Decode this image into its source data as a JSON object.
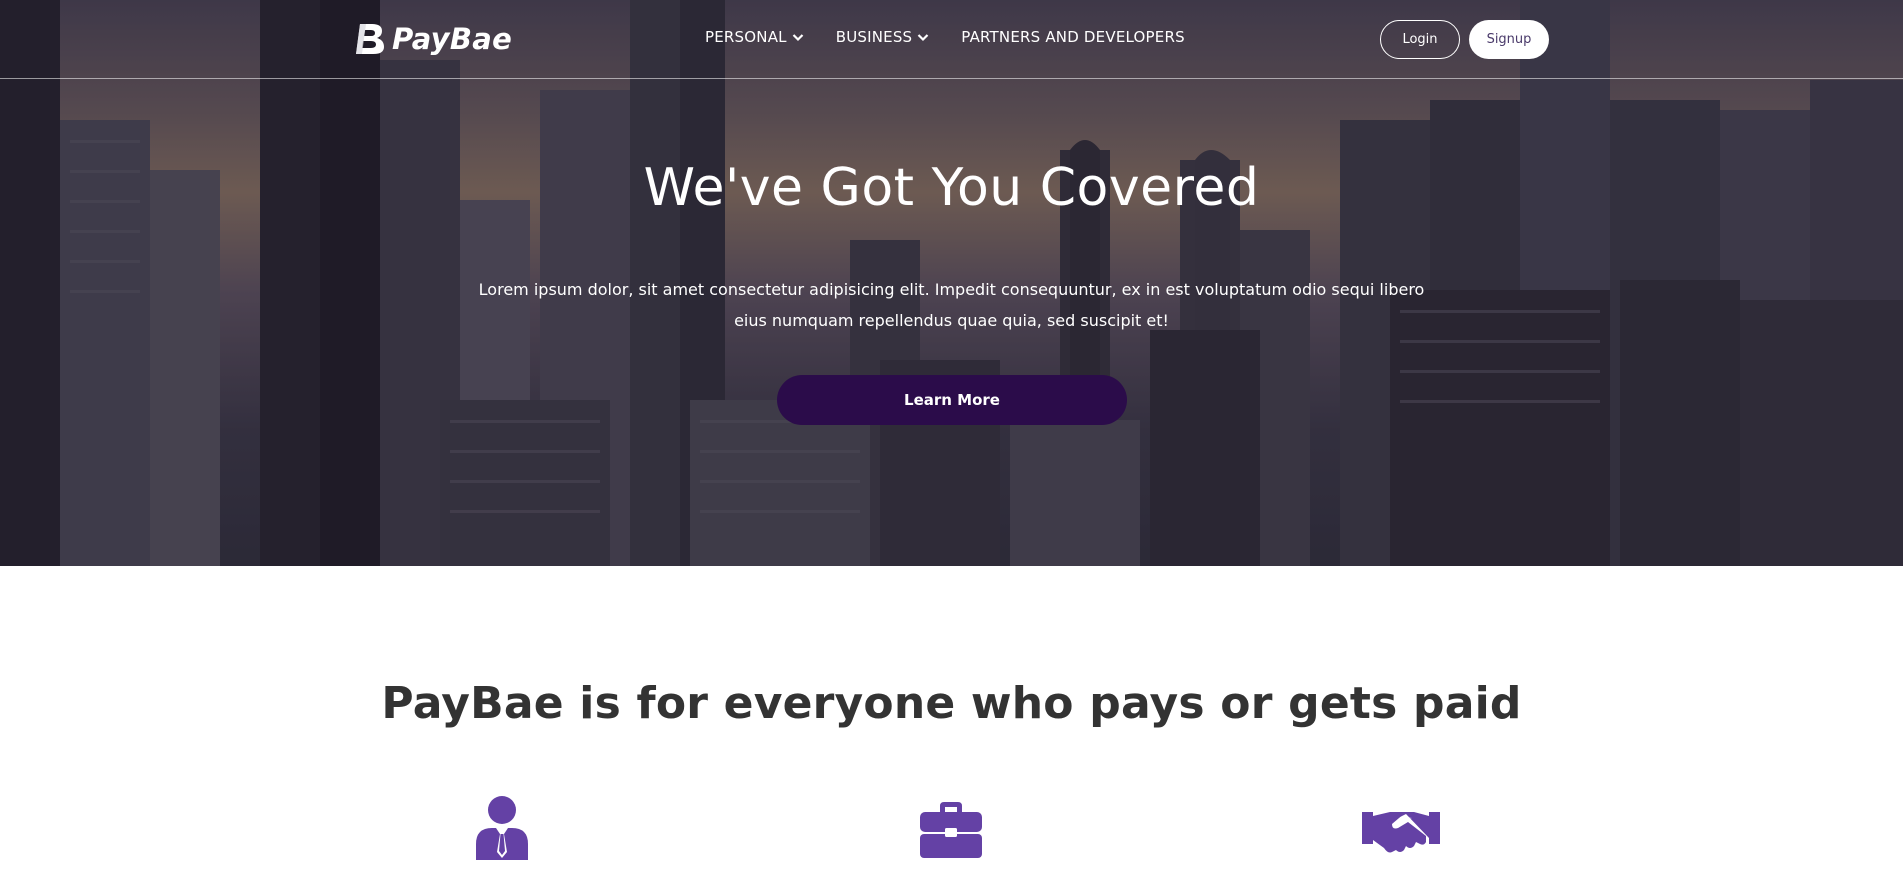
{
  "brand": {
    "name": "PayBae",
    "mark_icon": "paybae-b-logo",
    "accent_color": "#2b0c4a",
    "icon_color": "#6441a5"
  },
  "nav": {
    "links": [
      {
        "label": "PERSONAL",
        "dropdown": true
      },
      {
        "label": "BUSINESS",
        "dropdown": true
      },
      {
        "label": "PARTNERS AND DEVELOPERS",
        "dropdown": false
      }
    ],
    "login_label": "Login",
    "signup_label": "Signup"
  },
  "hero": {
    "title": "We've Got You Covered",
    "description": "Lorem ipsum dolor, sit amet consectetur adipisicing elit. Impedit consequuntur, ex in est voluptatum odio sequi libero eius numquam repellendus quae quia, sed suscipit et!",
    "cta_label": "Learn More"
  },
  "section": {
    "title": "PayBae is for everyone who pays or gets paid",
    "feature_icons": [
      "person-tie-icon",
      "briefcase-icon",
      "handshake-icon"
    ]
  }
}
